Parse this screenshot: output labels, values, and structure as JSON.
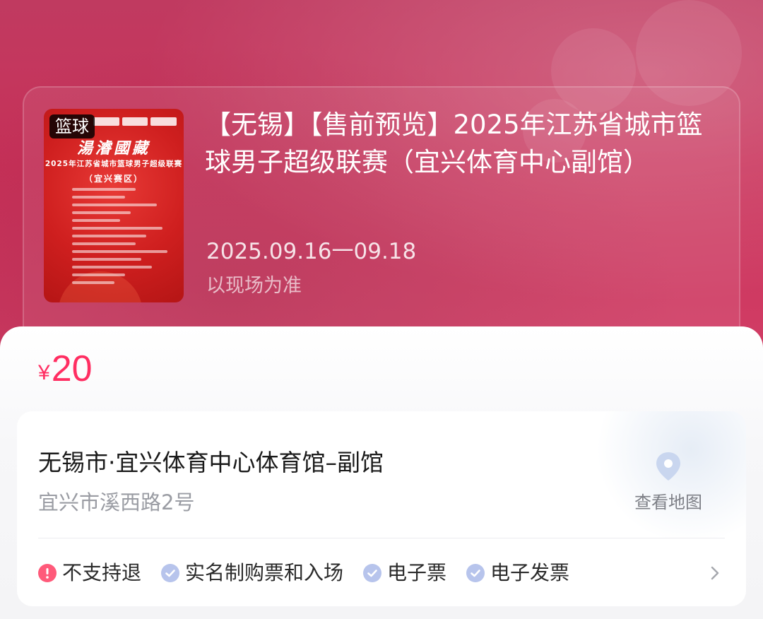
{
  "event": {
    "poster": {
      "tag": "篮球",
      "brand": "湯濬國藏",
      "title": "2025年江苏省城市篮球男子超级联赛",
      "subtitle": "（宜兴赛区）"
    },
    "title": "【无锡】【售前预览】2025年江苏省城市篮球男子超级联赛（宜兴体育中心副馆）",
    "date_range": "2025.09.16一09.18",
    "time_note": "以现场为准"
  },
  "price": {
    "currency": "¥",
    "amount": "20"
  },
  "venue": {
    "name": "无锡市·宜兴体育中心体育馆–副馆",
    "address": "宜兴市溪西路2号",
    "map_label": "查看地图"
  },
  "policies": [
    {
      "icon": "warning-icon",
      "label": "不支持退"
    },
    {
      "icon": "check-icon",
      "label": "实名制购票和入场"
    },
    {
      "icon": "check-icon",
      "label": "电子票"
    },
    {
      "icon": "check-icon",
      "label": "电子发票"
    }
  ],
  "colors": {
    "accent_price": "#ff2e62",
    "hero_bg": "#c8345c",
    "warning": "#ff5a7a",
    "check": "#b7c4ec"
  }
}
